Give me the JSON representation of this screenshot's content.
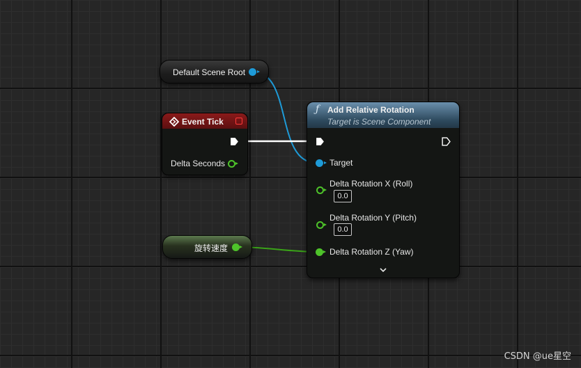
{
  "graph": {
    "scene_root_node": {
      "label": "Default Scene Root"
    },
    "event_tick_node": {
      "title": "Event Tick",
      "output_pin_label": "Delta Seconds"
    },
    "speed_var_node": {
      "label": "旋转速度"
    },
    "function_node": {
      "icon": "ƒ",
      "title": "Add Relative Rotation",
      "subtitle": "Target is Scene Component",
      "pins": {
        "target": "Target",
        "roll": "Delta Rotation X (Roll)",
        "roll_value": "0.0",
        "pitch": "Delta Rotation Y (Pitch)",
        "pitch_value": "0.0",
        "yaw": "Delta Rotation Z (Yaw)"
      },
      "expand_icon": "⌄"
    }
  },
  "colors": {
    "object_pin": "#1e9bd8",
    "float_pin": "#4ec32a",
    "exec_pin": "#ffffff",
    "event_header": "#8a1a1a",
    "function_header": "#4d6e88"
  },
  "watermark": "CSDN @ue星空"
}
